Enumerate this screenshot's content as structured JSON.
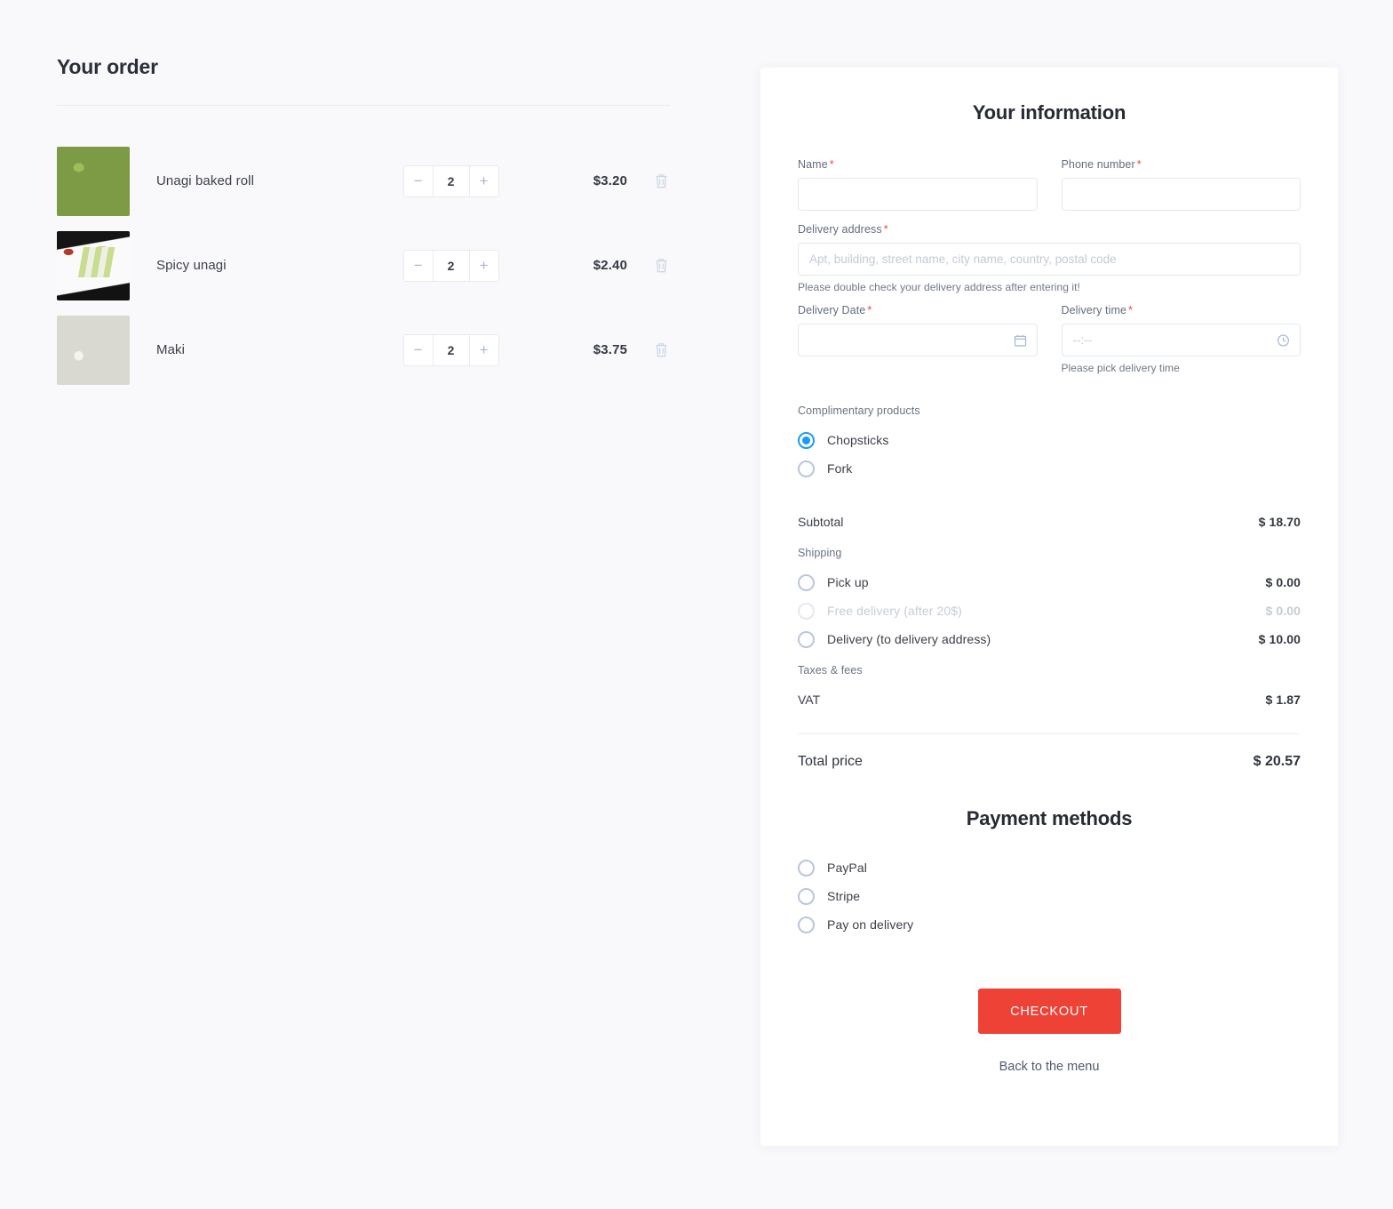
{
  "order": {
    "title": "Your order",
    "items": [
      {
        "name": "Unagi baked roll",
        "qty": "2",
        "price": "$3.20",
        "decrement": "−",
        "increment": "+",
        "thumb_class": "thumb-a"
      },
      {
        "name": "Spicy unagi",
        "qty": "2",
        "price": "$2.40",
        "decrement": "−",
        "increment": "+",
        "thumb_class": "thumb-b"
      },
      {
        "name": "Maki",
        "qty": "2",
        "price": "$3.75",
        "decrement": "−",
        "increment": "+",
        "thumb_class": "thumb-c"
      }
    ]
  },
  "info": {
    "title": "Your information",
    "name": {
      "label": "Name",
      "required": "*",
      "value": "",
      "placeholder": ""
    },
    "phone": {
      "label": "Phone number",
      "required": "*",
      "value": "",
      "placeholder": ""
    },
    "address": {
      "label": "Delivery address",
      "required": "*",
      "value": "",
      "placeholder": "Apt, building, street name, city name, country, postal code",
      "hint": "Please double check your delivery address after entering it!"
    },
    "date": {
      "label": "Delivery Date",
      "required": "*",
      "value": "",
      "placeholder": ""
    },
    "time": {
      "label": "Delivery time",
      "required": "*",
      "value": "",
      "placeholder": "--:--",
      "hint": "Please pick delivery time"
    }
  },
  "complimentary": {
    "label": "Complimentary products",
    "options": [
      {
        "label": "Chopsticks",
        "selected": true
      },
      {
        "label": "Fork",
        "selected": false
      }
    ]
  },
  "summary": {
    "subtotal_label": "Subtotal",
    "subtotal_value": "$ 18.70",
    "shipping_label": "Shipping",
    "shipping_options": [
      {
        "label": "Pick up",
        "amount": "$ 0.00",
        "selected": false,
        "disabled": false
      },
      {
        "label": "Free delivery (after 20$)",
        "amount": "$ 0.00",
        "selected": false,
        "disabled": true
      },
      {
        "label": "Delivery (to delivery address)",
        "amount": "$ 10.00",
        "selected": false,
        "disabled": false
      }
    ],
    "taxes_label": "Taxes & fees",
    "vat_label": "VAT",
    "vat_value": "$ 1.87",
    "total_label": "Total price",
    "total_value": "$ 20.57"
  },
  "payment": {
    "title": "Payment methods",
    "options": [
      {
        "label": "PayPal",
        "selected": false
      },
      {
        "label": "Stripe",
        "selected": false
      },
      {
        "label": "Pay on delivery",
        "selected": false
      }
    ]
  },
  "actions": {
    "checkout_label": "CHECKOUT",
    "back_label": "Back to the menu"
  },
  "colors": {
    "accent_red": "#ee4236",
    "radio_blue": "#1b9bf0",
    "page_bg": "#f9f9fc",
    "card_bg": "#ffffff"
  }
}
